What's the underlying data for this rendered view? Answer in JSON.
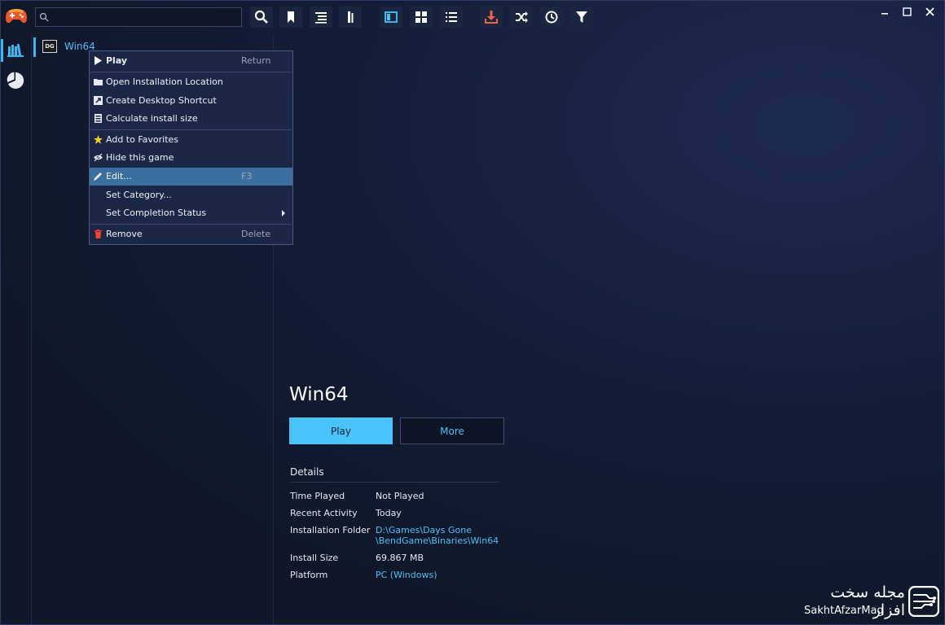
{
  "app": {
    "name": "Playnite"
  },
  "search": {
    "placeholder": "",
    "value": ""
  },
  "toolbar": {
    "buttons": [
      {
        "name": "search-icon"
      },
      {
        "name": "bookmark-icon"
      },
      {
        "name": "list-sort-icon"
      },
      {
        "name": "group-icon"
      },
      {
        "name": "details-view-icon"
      },
      {
        "name": "grid-view-icon"
      },
      {
        "name": "list-view-icon"
      },
      {
        "name": "download-icon"
      },
      {
        "name": "random-icon"
      },
      {
        "name": "update-icon"
      },
      {
        "name": "filter-icon"
      }
    ]
  },
  "window_controls": [
    "minimize",
    "maximize",
    "close"
  ],
  "sidebar": {
    "items": [
      {
        "name": "library-icon",
        "active": true
      },
      {
        "name": "statistics-icon",
        "active": false
      }
    ]
  },
  "games": [
    {
      "icon_text": "DG",
      "name": "Win64",
      "selected": true
    }
  ],
  "context_menu": {
    "items": [
      {
        "label": "Play",
        "shortcut": "Return",
        "icon": "play-icon",
        "bold": true
      },
      {
        "label": "Open Installation Location",
        "icon": "folder-icon"
      },
      {
        "label": "Create Desktop Shortcut",
        "icon": "shortcut-icon"
      },
      {
        "label": "Calculate install size",
        "icon": "disk-icon"
      },
      {
        "label": "Add to Favorites",
        "icon": "star-icon"
      },
      {
        "label": "Hide this game",
        "icon": "eye-icon"
      },
      {
        "label": "Edit...",
        "shortcut": "F3",
        "icon": "edit-icon",
        "highlighted": true
      },
      {
        "label": "Set Category...",
        "icon": ""
      },
      {
        "label": "Set Completion Status",
        "icon": "",
        "submenu": true
      },
      {
        "label": "Remove",
        "shortcut": "Delete",
        "icon": "trash-icon"
      }
    ]
  },
  "details": {
    "title": "Win64",
    "play_label": "Play",
    "more_label": "More",
    "section_title": "Details",
    "rows": [
      {
        "key": "Time Played",
        "value": "Not Played"
      },
      {
        "key": "Recent Activity",
        "value": "Today"
      },
      {
        "key": "Installation Folder",
        "value_line1": "D:\\Games\\Days Gone",
        "value_line2": "\\BendGame\\Binaries\\Win64"
      },
      {
        "key": "Install Size",
        "value": "69.867 MB"
      },
      {
        "key": "Platform",
        "value": "PC (Windows)"
      }
    ]
  },
  "watermark": {
    "persian": "مجله سخت افزار",
    "english": "SakhtAfzarMag"
  },
  "colors": {
    "accent": "#49c3fa",
    "link": "#4cc0f5",
    "highlight": "#3b6f9f",
    "background": "#111a2e"
  }
}
